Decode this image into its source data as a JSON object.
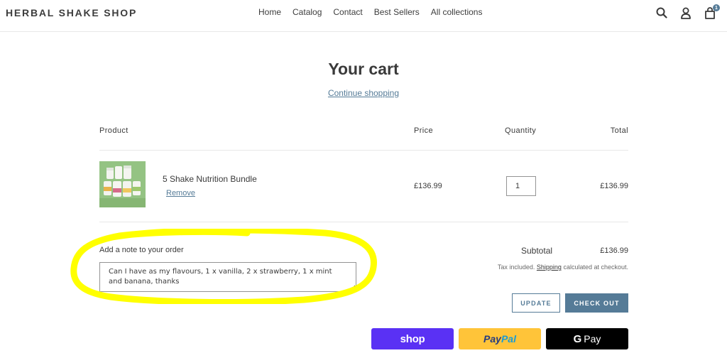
{
  "header": {
    "logo": "HERBAL SHAKE SHOP",
    "nav": [
      "Home",
      "Catalog",
      "Contact",
      "Best Sellers",
      "All collections"
    ],
    "cart_count": "1",
    "icons": [
      "search-icon",
      "account-icon",
      "cart-icon"
    ]
  },
  "page": {
    "title": "Your cart",
    "continue_link": "Continue shopping"
  },
  "table": {
    "headers": {
      "product": "Product",
      "price": "Price",
      "quantity": "Quantity",
      "total": "Total"
    },
    "items": [
      {
        "name": "5 Shake Nutrition Bundle",
        "remove": "Remove",
        "price": "£136.99",
        "quantity": "1",
        "total": "£136.99"
      }
    ]
  },
  "note": {
    "label": "Add a note to your order",
    "value": "Can I have as my flavours, 1 x vanilla, 2 x strawberry, 1 x mint and banana, thanks"
  },
  "summary": {
    "subtotal_label": "Subtotal",
    "subtotal_value": "£136.99",
    "tax_prefix": "Tax included.",
    "tax_link": "Shipping",
    "tax_suffix": "calculated at checkout.",
    "update_label": "UPDATE",
    "checkout_label": "CHECK OUT"
  },
  "payments": {
    "shop": "shop",
    "paypal_1": "Pay",
    "paypal_2": "Pal",
    "gpay_g": "G",
    "gpay_text": "Pay"
  },
  "colors": {
    "accent": "#557b97",
    "highlight": "#ffff00",
    "shop_pay": "#5a31f4",
    "paypal": "#ffc439",
    "gpay": "#000000"
  }
}
